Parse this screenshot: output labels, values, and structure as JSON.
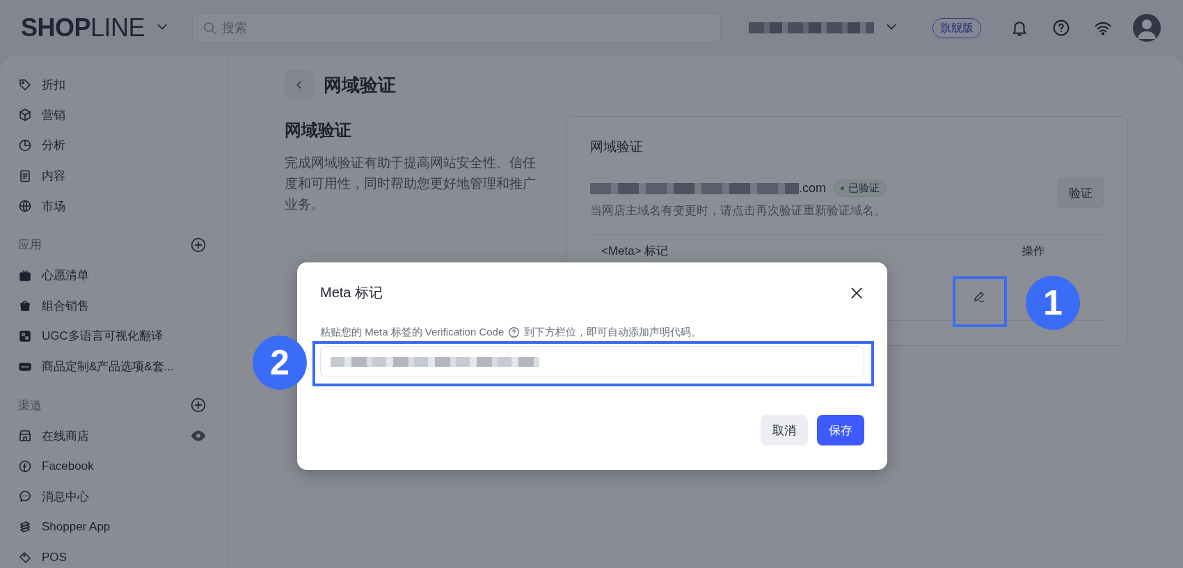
{
  "top_bar": {
    "logo": "**SHOP**LINE",
    "search": {
      "placeholder": "搜索"
    },
    "plan_badge": "旗舰版"
  },
  "sidebar": {
    "sections": [
      {
        "items": [
          {
            "label": "折扣"
          },
          {
            "label": "营销"
          },
          {
            "label": "分析"
          },
          {
            "label": "内容"
          },
          {
            "label": "市场"
          }
        ]
      },
      {
        "title": "应用",
        "items": [
          {
            "label": "心愿清单"
          },
          {
            "label": "组合销售"
          },
          {
            "label": "UGC多语言可视化翻译"
          },
          {
            "label": "商品定制&产品选项&套..."
          }
        ]
      },
      {
        "title": "渠道",
        "items": [
          {
            "label": "在线商店",
            "view_button": true
          },
          {
            "label": "Facebook"
          },
          {
            "label": "消息中心"
          },
          {
            "label": "Shopper App"
          },
          {
            "label": "POS"
          }
        ]
      }
    ]
  },
  "page": {
    "title": "网域验证",
    "section": {
      "title": "网域验证",
      "description": "完成网域验证有助于提高网站安全性、信任度和可用性，同时帮助您更好地管理和推广业务。"
    },
    "card": {
      "title": "网域验证",
      "domain_suffix": ".com",
      "status": "已验证",
      "hint": "当网店主域名有变更时，请点击再次验证重新验证域名。",
      "verify_button": "验证",
      "table": {
        "columns": [
          "<Meta> 标记",
          "操作"
        ]
      }
    }
  },
  "dialog": {
    "title": "Meta 标记",
    "label": "粘贴您的 Meta 标签的 Verification Code",
    "label_suffix": "到下方栏位，即可自动添加声明代码。",
    "buttons": [
      {
        "label": "取消",
        "kind": "secondary"
      },
      {
        "label": "保存",
        "kind": "primary"
      }
    ]
  },
  "annotations": [
    {
      "label": "1"
    },
    {
      "label": "2"
    }
  ]
}
